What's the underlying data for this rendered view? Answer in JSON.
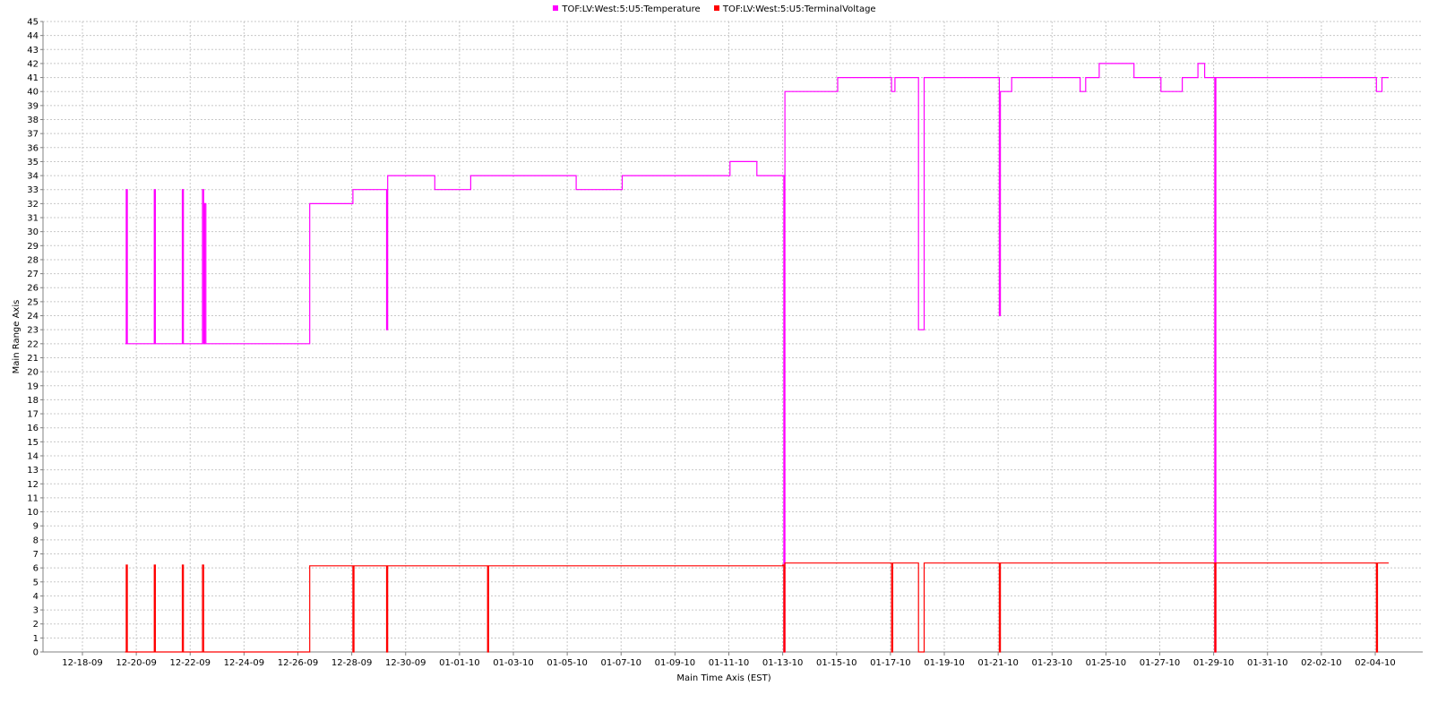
{
  "chart_data": {
    "type": "line",
    "title": "",
    "xlabel": "Main Time Axis (EST)",
    "ylabel": "Main Range Axis",
    "ylim": [
      0,
      45
    ],
    "yticks": [
      0,
      1,
      2,
      3,
      4,
      5,
      6,
      7,
      8,
      9,
      10,
      11,
      12,
      13,
      14,
      15,
      16,
      17,
      18,
      19,
      20,
      21,
      22,
      23,
      24,
      25,
      26,
      27,
      28,
      29,
      30,
      31,
      32,
      33,
      34,
      35,
      36,
      37,
      38,
      39,
      40,
      41,
      42,
      43,
      44,
      45
    ],
    "x_tick_labels": [
      "12-18-09",
      "12-20-09",
      "12-22-09",
      "12-24-09",
      "12-26-09",
      "12-28-09",
      "12-30-09",
      "01-01-10",
      "01-03-10",
      "01-05-10",
      "01-07-10",
      "01-09-10",
      "01-11-10",
      "01-13-10",
      "01-15-10",
      "01-17-10",
      "01-19-10",
      "01-21-10",
      "01-23-10",
      "01-25-10",
      "01-27-10",
      "01-29-10",
      "01-31-10",
      "02-02-10",
      "02-04-10"
    ],
    "grid": true,
    "legend_position": "top-center",
    "series": [
      {
        "name": "TOF:LV:West:5:U5:Temperature",
        "color": "#ff00ff",
        "points": [
          [
            "12-19-09 14:00",
            22
          ],
          [
            "12-19-09 15:00",
            33
          ],
          [
            "12-19-09 16:00",
            22
          ],
          [
            "12-20-09 15:00",
            22
          ],
          [
            "12-20-09 16:00",
            33
          ],
          [
            "12-20-09 17:00",
            22
          ],
          [
            "12-21-09 16:00",
            22
          ],
          [
            "12-21-09 17:00",
            33
          ],
          [
            "12-21-09 18:00",
            22
          ],
          [
            "12-22-09 10:00",
            22
          ],
          [
            "12-22-09 11:00",
            33
          ],
          [
            "12-22-09 12:00",
            22
          ],
          [
            "12-22-09 13:00",
            32
          ],
          [
            "12-22-09 14:00",
            22
          ],
          [
            "12-26-09 10:00",
            22
          ],
          [
            "12-26-09 10:30",
            32
          ],
          [
            "12-28-09 00:00",
            32
          ],
          [
            "12-28-09 01:00",
            33
          ],
          [
            "12-29-09 06:00",
            33
          ],
          [
            "12-29-09 07:00",
            23
          ],
          [
            "12-29-09 08:00",
            34
          ],
          [
            "12-31-09 01:00",
            34
          ],
          [
            "12-31-09 02:00",
            33
          ],
          [
            "01-01-10 09:00",
            33
          ],
          [
            "01-01-10 10:00",
            34
          ],
          [
            "01-05-10 07:00",
            34
          ],
          [
            "01-05-10 08:00",
            33
          ],
          [
            "01-07-10 00:00",
            33
          ],
          [
            "01-07-10 01:00",
            34
          ],
          [
            "01-11-10 00:00",
            34
          ],
          [
            "01-11-10 01:00",
            35
          ],
          [
            "01-12-10 00:00",
            35
          ],
          [
            "01-12-10 01:00",
            34
          ],
          [
            "01-13-10 00:00",
            34
          ],
          [
            "01-13-10 01:00",
            0
          ],
          [
            "01-13-10 02:00",
            40
          ],
          [
            "01-15-10 00:00",
            40
          ],
          [
            "01-15-10 01:00",
            41
          ],
          [
            "01-17-10 00:00",
            41
          ],
          [
            "01-17-10 01:00",
            40
          ],
          [
            "01-17-10 04:00",
            41
          ],
          [
            "01-18-10 00:00",
            41
          ],
          [
            "01-18-10 01:00",
            23
          ],
          [
            "01-18-10 06:00",
            41
          ],
          [
            "01-21-10 00:00",
            41
          ],
          [
            "01-21-10 01:00",
            24
          ],
          [
            "01-21-10 02:00",
            40
          ],
          [
            "01-21-10 12:00",
            41
          ],
          [
            "01-24-10 00:00",
            41
          ],
          [
            "01-24-10 01:00",
            40
          ],
          [
            "01-24-10 06:00",
            41
          ],
          [
            "01-24-10 18:00",
            42
          ],
          [
            "01-26-10 00:00",
            42
          ],
          [
            "01-26-10 01:00",
            41
          ],
          [
            "01-27-10 00:00",
            41
          ],
          [
            "01-27-10 01:00",
            40
          ],
          [
            "01-27-10 20:00",
            41
          ],
          [
            "01-28-10 10:00",
            42
          ],
          [
            "01-28-10 16:00",
            41
          ],
          [
            "01-29-10 00:00",
            41
          ],
          [
            "01-29-10 01:00",
            0
          ],
          [
            "01-29-10 02:00",
            41
          ],
          [
            "02-04-10 00:00",
            41
          ],
          [
            "02-04-10 01:00",
            40
          ],
          [
            "02-04-10 06:00",
            41
          ],
          [
            "02-04-10 12:00",
            41
          ]
        ]
      },
      {
        "name": "TOF:LV:West:5:U5:TerminalVoltage",
        "color": "#ff0000",
        "points": [
          [
            "12-19-09 14:00",
            0
          ],
          [
            "12-19-09 15:00",
            6.2
          ],
          [
            "12-19-09 16:00",
            0
          ],
          [
            "12-20-09 15:00",
            0
          ],
          [
            "12-20-09 16:00",
            6.2
          ],
          [
            "12-20-09 17:00",
            0
          ],
          [
            "12-21-09 16:00",
            0
          ],
          [
            "12-21-09 17:00",
            6.2
          ],
          [
            "12-21-09 18:00",
            0
          ],
          [
            "12-22-09 10:00",
            0
          ],
          [
            "12-22-09 11:00",
            6.2
          ],
          [
            "12-22-09 12:00",
            0
          ],
          [
            "12-26-09 10:30",
            0
          ],
          [
            "12-26-09 10:31",
            6.15
          ],
          [
            "12-28-09 00:00",
            6.15
          ],
          [
            "12-28-09 01:00",
            0
          ],
          [
            "12-28-09 02:00",
            6.15
          ],
          [
            "12-29-09 06:00",
            6.15
          ],
          [
            "12-29-09 07:00",
            0
          ],
          [
            "12-29-09 08:00",
            6.15
          ],
          [
            "01-02-10 00:00",
            6.15
          ],
          [
            "01-02-10 01:00",
            0
          ],
          [
            "01-02-10 02:00",
            6.15
          ],
          [
            "01-13-10 00:00",
            6.2
          ],
          [
            "01-13-10 01:00",
            0
          ],
          [
            "01-13-10 02:00",
            6.35
          ],
          [
            "01-17-10 00:00",
            6.35
          ],
          [
            "01-17-10 01:00",
            0
          ],
          [
            "01-17-10 02:00",
            6.35
          ],
          [
            "01-18-10 00:00",
            6.35
          ],
          [
            "01-18-10 01:00",
            0
          ],
          [
            "01-18-10 06:00",
            6.35
          ],
          [
            "01-21-10 00:00",
            6.35
          ],
          [
            "01-21-10 01:00",
            0
          ],
          [
            "01-21-10 02:00",
            6.35
          ],
          [
            "01-29-10 00:00",
            6.35
          ],
          [
            "01-29-10 01:00",
            0
          ],
          [
            "01-29-10 02:00",
            6.35
          ],
          [
            "02-04-10 00:00",
            6.35
          ],
          [
            "02-04-10 01:00",
            0
          ],
          [
            "02-04-10 02:00",
            6.35
          ],
          [
            "02-04-10 12:00",
            6.35
          ]
        ]
      }
    ]
  }
}
